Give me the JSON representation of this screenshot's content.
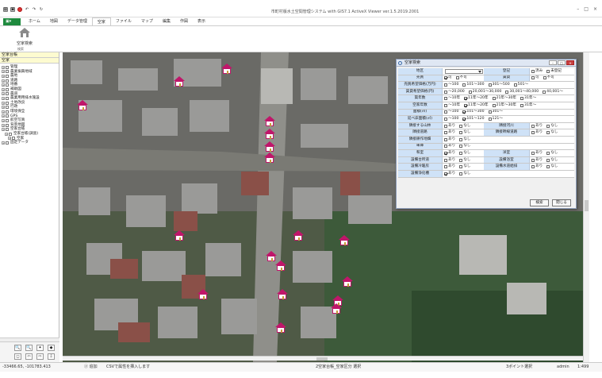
{
  "app": {
    "title": "市町村版水土空間管理システム  with GIS7.1 ActiveX Viewer  ver.1.5.2019.2001",
    "quick_icons": [
      "app-menu-icon",
      "save-icon",
      "red-circle-icon",
      "undo-icon",
      "redo-icon",
      "refresh-icon"
    ],
    "window_controls": [
      "–",
      "□",
      "×"
    ]
  },
  "ribbon": {
    "file_label": "ファイル",
    "tabs": [
      "ホーム",
      "地図",
      "データ管理",
      "空家",
      "ファイル",
      "マップ",
      "編集",
      "作図",
      "表示"
    ],
    "active_tab": "空家",
    "button_label": "空家検索",
    "group_label": "検索"
  },
  "sidebar": {
    "header_1": "空家台帳",
    "header_2": "空家",
    "tree": [
      {
        "label": "管理",
        "level": 0,
        "checked": true
      },
      {
        "label": "農業振興地域",
        "level": 0,
        "checked": true
      },
      {
        "label": "農地",
        "level": 0,
        "checked": true
      },
      {
        "label": "道路",
        "level": 0,
        "checked": true
      },
      {
        "label": "地番",
        "level": 0,
        "checked": true
      },
      {
        "label": "補助図",
        "level": 0,
        "checked": true
      },
      {
        "label": "農道",
        "level": 0,
        "checked": true
      },
      {
        "label": "農業用用排水施設",
        "level": 0,
        "checked": true
      },
      {
        "label": "土地改良",
        "level": 0,
        "checked": true
      },
      {
        "label": "行政",
        "level": 0,
        "checked": true
      },
      {
        "label": "環境保全",
        "level": 0,
        "checked": true
      },
      {
        "label": "GPS",
        "level": 0,
        "checked": true
      },
      {
        "label": "航空写真",
        "level": 0,
        "checked": true
      },
      {
        "label": "背景地図",
        "level": 0,
        "checked": true
      },
      {
        "label": "空家台帳",
        "level": 0,
        "checked": true
      },
      {
        "label": "空家台帳(調査)",
        "level": 1,
        "checked": true
      },
      {
        "label": "空家",
        "level": 2,
        "checked": true
      },
      {
        "label": "固定データ",
        "level": 0,
        "checked": true
      }
    ],
    "tool_row_1": [
      "🔍",
      "🔍",
      "✦",
      "◆"
    ],
    "tool_row_2": [
      "◻",
      "⇦",
      "⇨",
      "⇩"
    ]
  },
  "dialog": {
    "title": "空家検索",
    "rows": [
      {
        "label": "地区",
        "type": "select",
        "value": "",
        "label2": "登記",
        "opts2": [
          [
            "済み",
            false
          ],
          [
            "未登記",
            false
          ]
        ]
      },
      {
        "label": "売買",
        "opts": [
          [
            "可",
            true
          ],
          [
            "不可",
            false
          ]
        ],
        "label2": "賃貸",
        "opts2": [
          [
            "可",
            false
          ],
          [
            "不可",
            false
          ]
        ]
      },
      {
        "label": "売買希望価格(万円)",
        "opts": [
          [
            "～100",
            false
          ],
          [
            "101～300",
            false
          ],
          [
            "301～500",
            false
          ],
          [
            "501～",
            false
          ]
        ]
      },
      {
        "label": "賃貸希望価格(円)",
        "opts": [
          [
            "～20,000",
            false
          ],
          [
            "20,001～30,000",
            false
          ],
          [
            "30,001～40,000",
            false
          ],
          [
            "40,001～",
            false
          ]
        ]
      },
      {
        "label": "築年数",
        "opts": [
          [
            "～10年",
            false
          ],
          [
            "11年～20年",
            true
          ],
          [
            "21年～30年",
            false
          ],
          [
            "31年～",
            false
          ]
        ]
      },
      {
        "label": "空家年数",
        "opts": [
          [
            "～10年",
            false
          ],
          [
            "11年～20年",
            true
          ],
          [
            "21年～30年",
            false
          ],
          [
            "31年～",
            false
          ]
        ]
      },
      {
        "label": "面積(㎡)",
        "opts": [
          [
            "～100",
            false
          ],
          [
            "101～300",
            true
          ],
          [
            "301～",
            false
          ]
        ]
      },
      {
        "label": "延べ床面積(㎡)",
        "opts": [
          [
            "～100",
            false
          ],
          [
            "101～120",
            true
          ],
          [
            "121～",
            false
          ]
        ]
      },
      {
        "label": "隣接する山林",
        "opts": [
          [
            "あり",
            false
          ],
          [
            "なし",
            false
          ]
        ],
        "label2": "隣接河川",
        "opts2": [
          [
            "あり",
            false
          ],
          [
            "なし",
            false
          ]
        ]
      },
      {
        "label": "隣接道路",
        "opts": [
          [
            "あり",
            false
          ],
          [
            "なし",
            false
          ]
        ],
        "label2": "隣接幹線道路",
        "opts2": [
          [
            "あり",
            false
          ],
          [
            "なし",
            false
          ]
        ]
      },
      {
        "label": "隣接耕作地畑",
        "opts": [
          [
            "あり",
            false
          ],
          [
            "なし",
            false
          ]
        ]
      },
      {
        "label": "車庫",
        "opts": [
          [
            "あり",
            false
          ],
          [
            "なし",
            false
          ]
        ]
      },
      {
        "label": "和室",
        "opts": [
          [
            "あり",
            true
          ],
          [
            "なし",
            false
          ]
        ],
        "label2": "洋室",
        "opts2": [
          [
            "あり",
            false
          ],
          [
            "なし",
            false
          ]
        ]
      },
      {
        "label": "設備台所道",
        "opts": [
          [
            "あり",
            false
          ],
          [
            "なし",
            false
          ]
        ],
        "label2": "設備浴室",
        "opts2": [
          [
            "あり",
            false
          ],
          [
            "なし",
            false
          ]
        ]
      },
      {
        "label": "設備冷暖房",
        "opts": [
          [
            "あり",
            false
          ],
          [
            "なし",
            false
          ]
        ],
        "label2": "設備水道給排",
        "opts2": [
          [
            "あり",
            false
          ],
          [
            "なし",
            false
          ]
        ]
      },
      {
        "label": "設備浄化槽",
        "opts": [
          [
            "あり",
            true
          ],
          [
            "なし",
            false
          ]
        ]
      }
    ],
    "search_button": "検索",
    "close_button": "閉じる"
  },
  "status": {
    "coords": "-33466.65, -101783.413",
    "mode_label": "ⓨ 追加",
    "hint": "CSVで属性を挿入します",
    "layer_info": "2空家台帳_空家区分 選択",
    "point_mode": "3ポイント選択",
    "user": "admin",
    "scale": "1:499"
  },
  "colors": {
    "accent_green": "#1e8a3e",
    "marker_magenta": "#c0166a",
    "dialog_label_bg": "#cfe2f7"
  }
}
